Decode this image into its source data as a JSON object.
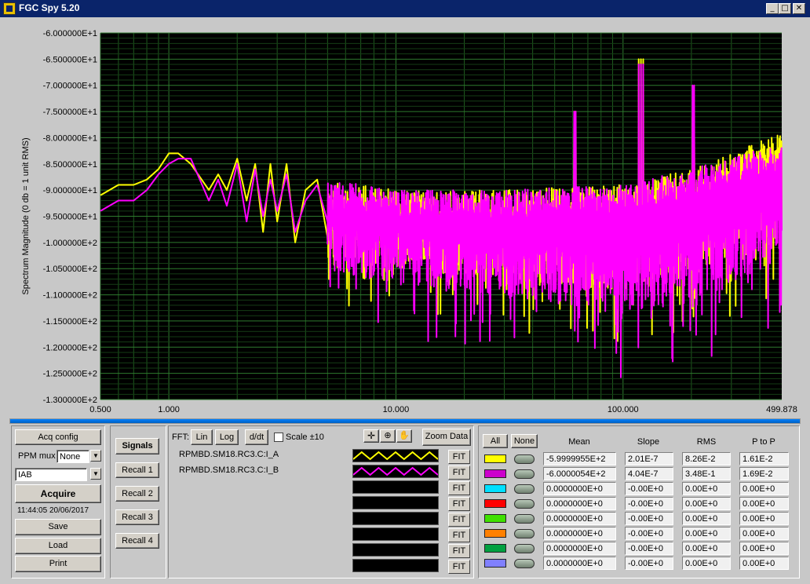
{
  "window": {
    "title": "FGC Spy 5.20"
  },
  "chart_data": {
    "type": "line",
    "ylabel": "Spectrum Magnitude (0 db = 1 unit RMS)",
    "xscale": "log",
    "xlim": [
      0.5,
      499.878
    ],
    "ylim": [
      -130,
      -60
    ],
    "x_ticks": [
      "0.500",
      "1.000",
      "10.000",
      "100.000",
      "499.878"
    ],
    "y_ticks": [
      "-6.000000E+1",
      "-6.500000E+1",
      "-7.000000E+1",
      "-7.500000E+1",
      "-8.000000E+1",
      "-8.500000E+1",
      "-9.000000E+1",
      "-9.500000E+1",
      "-1.000000E+2",
      "-1.050000E+2",
      "-1.100000E+2",
      "-1.150000E+2",
      "-1.200000E+2",
      "-1.250000E+2",
      "-1.300000E+2"
    ],
    "grid": true,
    "background": "#000000",
    "series": [
      {
        "color": "#ff00ff",
        "x": [
          0.5,
          0.6,
          0.7,
          0.8,
          0.9,
          1.0,
          1.1,
          1.25,
          1.5,
          1.65,
          1.8,
          2.0,
          2.2,
          2.4,
          2.6,
          2.8,
          3.0,
          3.3,
          3.6,
          4.0,
          4.5,
          5.0,
          5.5,
          6.0,
          7.0,
          8.0,
          10,
          15,
          20,
          30,
          50,
          70,
          100,
          120,
          150,
          200,
          300,
          400,
          499.878
        ],
        "y": [
          -94,
          -92,
          -92,
          -90,
          -87,
          -85,
          -84,
          -84,
          -92,
          -88,
          -93,
          -85,
          -96,
          -86,
          -95,
          -88,
          -94,
          -87,
          -98,
          -92,
          -89,
          -96,
          -98,
          -94,
          -97,
          -99,
          -101,
          -100,
          -102,
          -103,
          -102,
          -101,
          -101,
          -65,
          -100,
          -98,
          -97,
          -94,
          -93
        ],
        "band": [
          [
            5,
            -115,
            -88
          ],
          [
            10,
            -118,
            -90
          ],
          [
            30,
            -121,
            -90
          ],
          [
            100,
            -126,
            -89
          ],
          [
            200,
            -124,
            -86
          ],
          [
            499.878,
            -115,
            -81
          ]
        ]
      },
      {
        "color": "#ffff00",
        "x": [
          0.5,
          0.6,
          0.7,
          0.8,
          0.9,
          1.0,
          1.1,
          1.25,
          1.5,
          1.65,
          1.8,
          2.0,
          2.2,
          2.4,
          2.6,
          2.8,
          3.0,
          3.3,
          3.6,
          4.0,
          4.5,
          5.0,
          5.5,
          6.0,
          7.0,
          8.0,
          10,
          15,
          20,
          30,
          50,
          70,
          100,
          120,
          150,
          200,
          300,
          400,
          499.878
        ],
        "y": [
          -91,
          -89,
          -89,
          -88,
          -86,
          -83,
          -83,
          -85,
          -90,
          -87,
          -90,
          -84,
          -92,
          -85,
          -98,
          -85,
          -96,
          -85,
          -100,
          -90,
          -88,
          -99,
          -102,
          -97,
          -100,
          -101,
          -99,
          -98,
          -99,
          -99,
          -98,
          -97,
          -96,
          -66,
          -96,
          -94,
          -92,
          -90,
          -88
        ],
        "band": [
          [
            5,
            -112,
            -88
          ],
          [
            10,
            -114,
            -90
          ],
          [
            30,
            -117,
            -90
          ],
          [
            100,
            -120,
            -89
          ],
          [
            200,
            -118,
            -86
          ],
          [
            499.878,
            -110,
            -79
          ]
        ]
      }
    ]
  },
  "acq": {
    "acq_config_label": "Acq config",
    "ppm_mux_label": "PPM mux",
    "ppm_mux_value": "None",
    "signal_select_value": "IAB",
    "acquire_label": "Acquire",
    "timestamp": "11:44:05 20/06/2017",
    "save_label": "Save",
    "load_label": "Load",
    "print_label": "Print"
  },
  "recall": {
    "signals_label": "Signals",
    "items": [
      "Recall 1",
      "Recall 2",
      "Recall 3",
      "Recall 4"
    ]
  },
  "fft": {
    "label": "FFT:",
    "lin_label": "Lin",
    "log_label": "Log",
    "ddt_label": "d/dt",
    "scale_label": "Scale ±10",
    "zoom_data_label": "Zoom Data",
    "tool_icons": [
      "crosshair-icon",
      "zoom-icon",
      "pan-hand-icon"
    ]
  },
  "signals": [
    {
      "name": "RPMBD.SM18.RC3.C:I_A",
      "color": "#ffff00",
      "fit": "FIT"
    },
    {
      "name": "RPMBD.SM18.RC3.C:I_B",
      "color": "#ff00ff",
      "fit": "FIT"
    },
    {
      "name": "",
      "color": "",
      "fit": "FIT"
    },
    {
      "name": "",
      "color": "",
      "fit": "FIT"
    },
    {
      "name": "",
      "color": "",
      "fit": "FIT"
    },
    {
      "name": "",
      "color": "",
      "fit": "FIT"
    },
    {
      "name": "",
      "color": "",
      "fit": "FIT"
    },
    {
      "name": "",
      "color": "",
      "fit": "FIT"
    }
  ],
  "stats": {
    "all_label": "All",
    "none_label": "None",
    "headers": [
      "Mean",
      "Slope",
      "RMS",
      "P to P"
    ],
    "rows": [
      {
        "color": "#ffff00",
        "mean": "-5.9999955E+2",
        "slope": "2.01E-7",
        "rms": "8.26E-2",
        "ptp": "1.61E-2"
      },
      {
        "color": "#cc00cc",
        "mean": "-6.0000054E+2",
        "slope": "4.04E-7",
        "rms": "3.48E-1",
        "ptp": "1.69E-2"
      },
      {
        "color": "#00e0ff",
        "mean": "0.0000000E+0",
        "slope": "-0.00E+0",
        "rms": "0.00E+0",
        "ptp": "0.00E+0"
      },
      {
        "color": "#ff0000",
        "mean": "0.0000000E+0",
        "slope": "-0.00E+0",
        "rms": "0.00E+0",
        "ptp": "0.00E+0"
      },
      {
        "color": "#40e000",
        "mean": "0.0000000E+0",
        "slope": "-0.00E+0",
        "rms": "0.00E+0",
        "ptp": "0.00E+0"
      },
      {
        "color": "#ff8000",
        "mean": "0.0000000E+0",
        "slope": "-0.00E+0",
        "rms": "0.00E+0",
        "ptp": "0.00E+0"
      },
      {
        "color": "#00a040",
        "mean": "0.0000000E+0",
        "slope": "-0.00E+0",
        "rms": "0.00E+0",
        "ptp": "0.00E+0"
      },
      {
        "color": "#8080ff",
        "mean": "0.0000000E+0",
        "slope": "-0.00E+0",
        "rms": "0.00E+0",
        "ptp": "0.00E+0"
      }
    ]
  }
}
